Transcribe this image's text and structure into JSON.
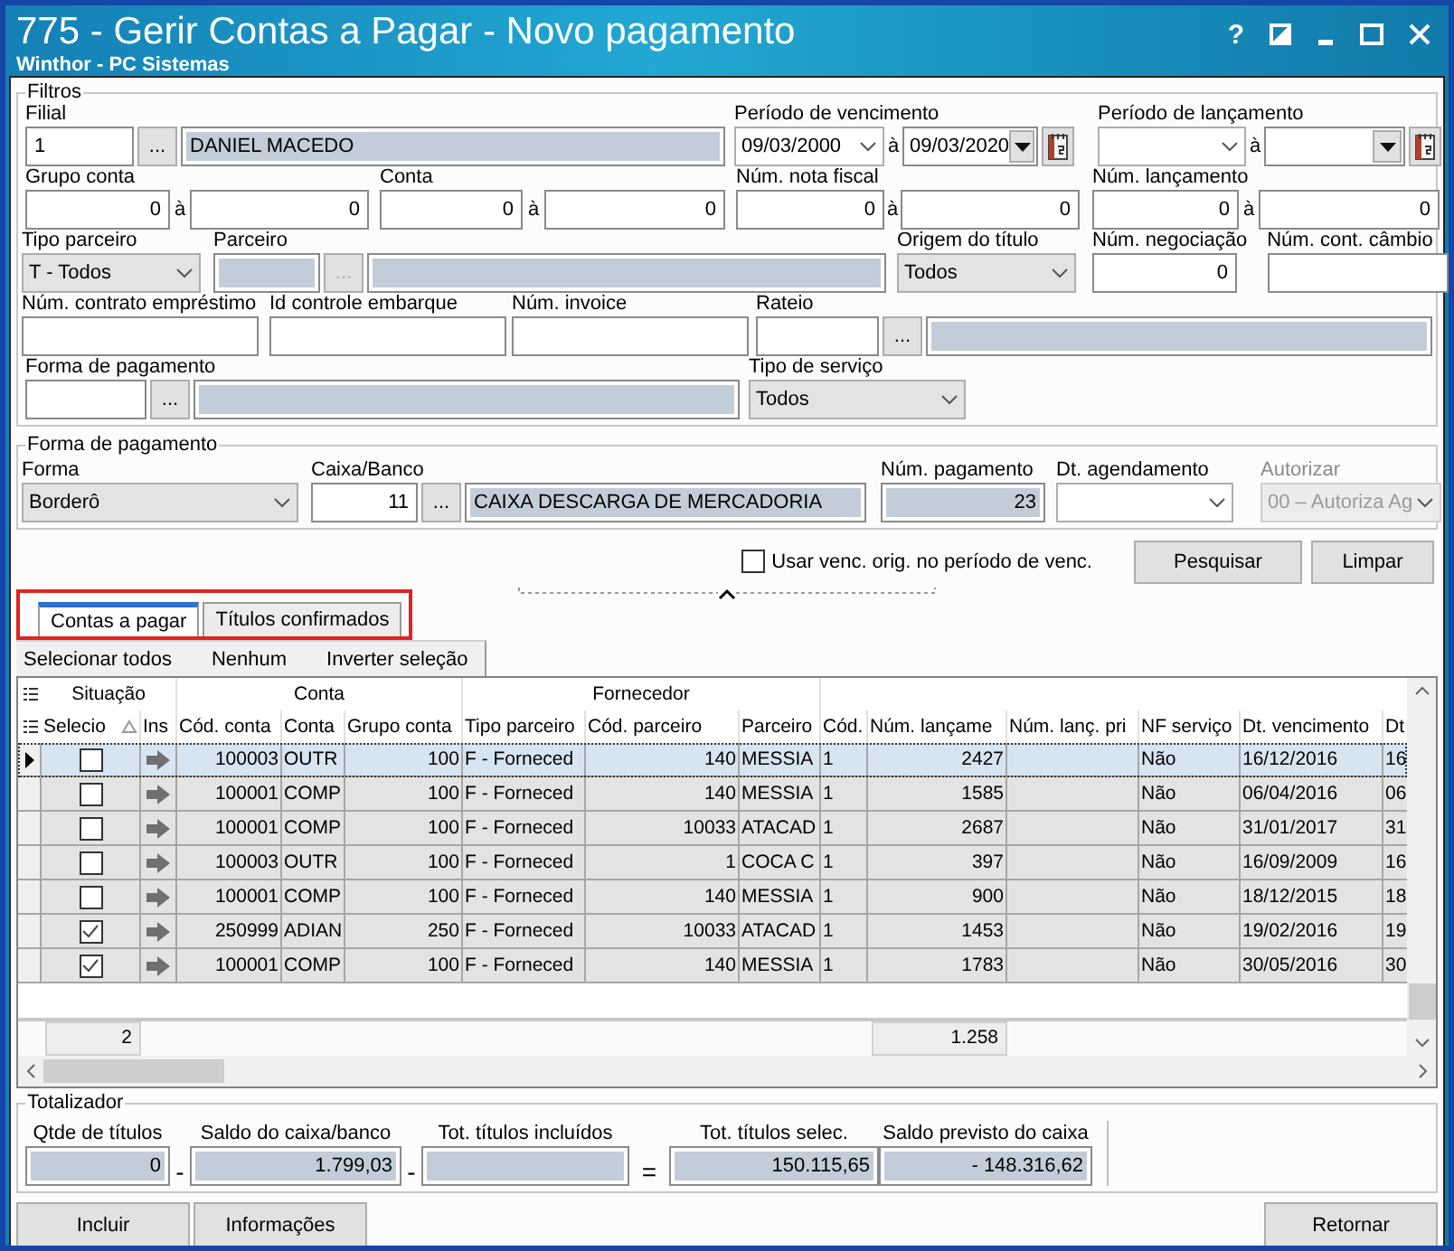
{
  "window": {
    "title": "775 - Gerir Contas a Pagar - Novo pagamento",
    "subtitle": "Winthor - PC Sistemas",
    "help": "?"
  },
  "filters": {
    "legend": "Filtros",
    "filial": {
      "label": "Filial",
      "code": "1",
      "lookup": "...",
      "name": "DANIEL MACEDO"
    },
    "periodo_vencimento": {
      "label": "Período  de vencimento",
      "from": "09/03/2000",
      "sep": "à",
      "to": "09/03/2020"
    },
    "periodo_lancamento": {
      "label": "Período  de lançamento",
      "sep": "à"
    },
    "grupo_conta": {
      "label": "Grupo conta",
      "from": "0",
      "sep": "à",
      "to": "0"
    },
    "conta": {
      "label": "Conta",
      "from": "0",
      "sep": "à",
      "to": "0"
    },
    "num_nota_fiscal": {
      "label": "Núm. nota fiscal",
      "from": "0",
      "sep": "à",
      "to": "0"
    },
    "num_lancamento": {
      "label": "Núm. lançamento",
      "from": "0",
      "sep": "à",
      "to": "0"
    },
    "tipo_parceiro": {
      "label": "Tipo parceiro",
      "value": "T - Todos"
    },
    "parceiro": {
      "label": "Parceiro",
      "lookup": "...",
      "disabled": true
    },
    "origem_titulo": {
      "label": "Origem do título",
      "value": "Todos"
    },
    "num_negociacao": {
      "label": "Núm. negociação",
      "value": "0"
    },
    "num_cont_cambio": {
      "label": "Núm. cont. câmbio"
    },
    "num_contrato_emprestimo": {
      "label": "Núm. contrato empréstimo"
    },
    "id_controle_embarque": {
      "label": "Id controle embarque"
    },
    "num_invoice": {
      "label": "Núm. invoice"
    },
    "rateio": {
      "label": "Rateio",
      "lookup": "..."
    },
    "forma_pagamento": {
      "label": "Forma de pagamento",
      "lookup": "..."
    },
    "tipo_servico": {
      "label": "Tipo de serviço",
      "value": "Todos"
    }
  },
  "payment": {
    "legend": "Forma de pagamento",
    "forma": {
      "label": "Forma",
      "value": "Borderô"
    },
    "caixa_banco": {
      "label": "Caixa/Banco",
      "code": "11",
      "lookup": "...",
      "name": "CAIXA DESCARGA DE MERCADORIA"
    },
    "num_pagamento": {
      "label": "Núm. pagamento",
      "value": "23"
    },
    "dt_agendamento": {
      "label": "Dt. agendamento"
    },
    "autorizar": {
      "label": "Autorizar",
      "value": "00 – Autoriza Ag",
      "disabled": true
    }
  },
  "use_orig_due": {
    "label": "Usar venc. orig. no período de venc.",
    "checked": false
  },
  "actions": [
    "Pesquisar",
    "Limpar"
  ],
  "tabs_highlighted": true,
  "tabs": [
    {
      "label": "Contas a pagar",
      "selected": true
    },
    {
      "label": "Títulos confirmados",
      "selected": false
    }
  ],
  "grid_toolbar": [
    "Selecionar todos",
    "Nenhum",
    "Inverter seleção"
  ],
  "grid": {
    "bands": [
      "Situação",
      "Conta",
      "Fornecedor"
    ],
    "columns": [
      "Selecio",
      "Ins",
      "Cód. conta",
      "Conta",
      "Grupo conta",
      "Tipo parceiro",
      "Cód. parceiro",
      "Parceiro",
      "Cód.",
      "Núm. lançame",
      "Núm. lanç. pri",
      "NF serviço",
      "Dt. vencimento",
      "Dt"
    ],
    "rows": [
      {
        "selected": true,
        "checked": false,
        "cod_conta": "100003",
        "conta": "OUTR",
        "grupo_conta": "100",
        "tipo_parceiro": "F - Forneced",
        "cod_parceiro": "140",
        "parceiro": "MESSIA",
        "cod": "1",
        "num_lancamento": "2427",
        "nf_servico": "Não",
        "dt_vencimento": "16/12/2016",
        "dt": "16"
      },
      {
        "selected": false,
        "checked": false,
        "cod_conta": "100001",
        "conta": "COMP",
        "grupo_conta": "100",
        "tipo_parceiro": "F - Forneced",
        "cod_parceiro": "140",
        "parceiro": "MESSIA",
        "cod": "1",
        "num_lancamento": "1585",
        "nf_servico": "Não",
        "dt_vencimento": "06/04/2016",
        "dt": "06"
      },
      {
        "selected": false,
        "checked": false,
        "cod_conta": "100001",
        "conta": "COMP",
        "grupo_conta": "100",
        "tipo_parceiro": "F - Forneced",
        "cod_parceiro": "10033",
        "parceiro": "ATACAD",
        "cod": "1",
        "num_lancamento": "2687",
        "nf_servico": "Não",
        "dt_vencimento": "31/01/2017",
        "dt": "31"
      },
      {
        "selected": false,
        "checked": false,
        "cod_conta": "100003",
        "conta": "OUTR",
        "grupo_conta": "100",
        "tipo_parceiro": "F - Forneced",
        "cod_parceiro": "1",
        "parceiro": "COCA C",
        "cod": "1",
        "num_lancamento": "397",
        "nf_servico": "Não",
        "dt_vencimento": "16/09/2009",
        "dt": "16"
      },
      {
        "selected": false,
        "checked": false,
        "cod_conta": "100001",
        "conta": "COMP",
        "grupo_conta": "100",
        "tipo_parceiro": "F - Forneced",
        "cod_parceiro": "140",
        "parceiro": "MESSIA",
        "cod": "1",
        "num_lancamento": "900",
        "nf_servico": "Não",
        "dt_vencimento": "18/12/2015",
        "dt": "18"
      },
      {
        "selected": false,
        "checked": true,
        "cod_conta": "250999",
        "conta": "ADIAN",
        "grupo_conta": "250",
        "tipo_parceiro": "F - Forneced",
        "cod_parceiro": "10033",
        "parceiro": "ATACAD",
        "cod": "1",
        "num_lancamento": "1453",
        "nf_servico": "Não",
        "dt_vencimento": "19/02/2016",
        "dt": "19"
      },
      {
        "selected": false,
        "checked": true,
        "cod_conta": "100001",
        "conta": "COMP",
        "grupo_conta": "100",
        "tipo_parceiro": "F - Forneced",
        "cod_parceiro": "140",
        "parceiro": "MESSIA",
        "cod": "1",
        "num_lancamento": "1783",
        "nf_servico": "Não",
        "dt_vencimento": "30/05/2016",
        "dt": "30"
      }
    ],
    "footer": {
      "count": "2",
      "total": "1.258"
    }
  },
  "totalizer": {
    "legend": "Totalizador",
    "fields": [
      {
        "label": "Qtde de títulos",
        "value": "0"
      },
      {
        "label": "Saldo do caixa/banco",
        "value": "1.799,03"
      },
      {
        "label": "Tot. títulos incluídos"
      },
      {
        "label": "Tot. títulos selec.",
        "value": "150.115,65"
      },
      {
        "label": "Saldo previsto do caixa",
        "value": "- 148.316,62"
      }
    ],
    "operators": [
      "-",
      "-",
      "="
    ]
  },
  "buttons": {
    "left": [
      "Incluir",
      "Informações"
    ],
    "right": [
      "Retornar"
    ]
  }
}
